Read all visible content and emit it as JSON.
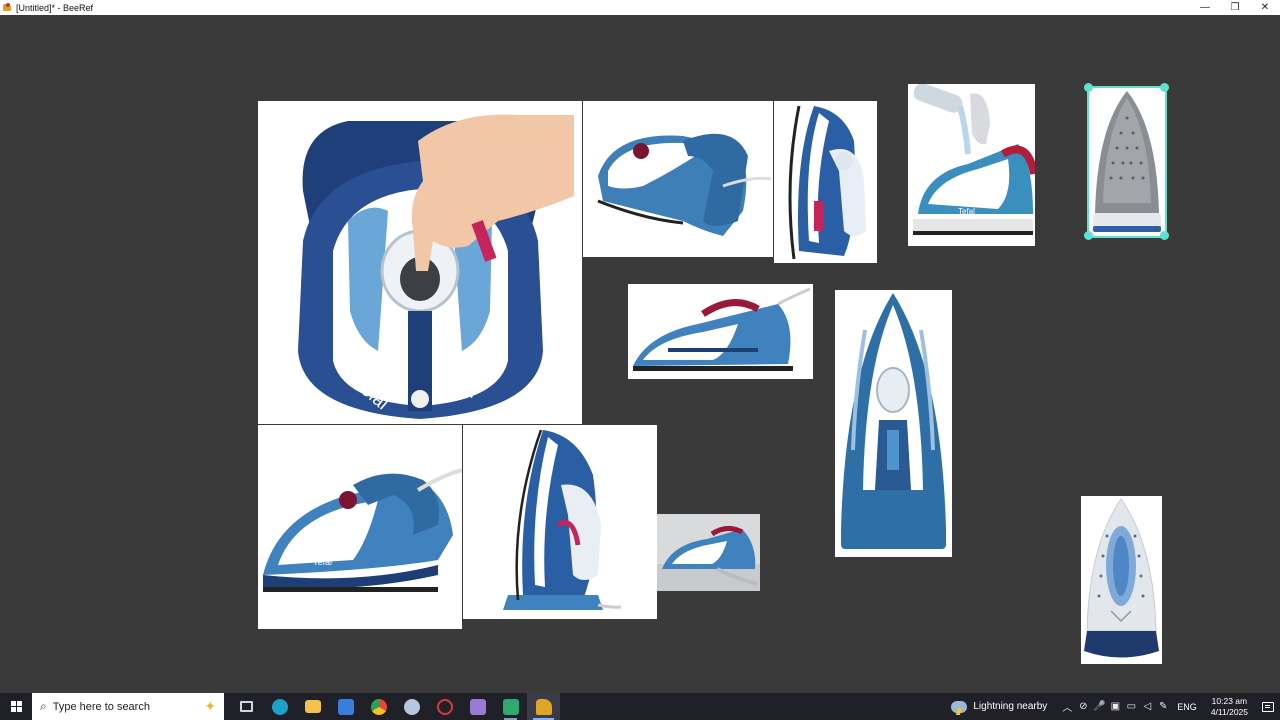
{
  "window": {
    "title": "[Untitled]* - BeeRef",
    "minimize_glyph": "—",
    "restore_glyph": "❐",
    "close_glyph": "✕"
  },
  "canvas": {
    "background": "#3a3a3a",
    "selection_color": "#5fe0d2",
    "items": [
      {
        "name": "iron-refill-closeup",
        "description_icon": "steam-iron-top-view-image"
      },
      {
        "name": "iron-angled-left",
        "description_icon": "steam-iron-image"
      },
      {
        "name": "iron-upright-side",
        "description_icon": "steam-iron-image"
      },
      {
        "name": "iron-water-pour",
        "description_icon": "steam-iron-image"
      },
      {
        "name": "iron-soleplate-grey",
        "description_icon": "soleplate-image"
      },
      {
        "name": "iron-side-view",
        "description_icon": "steam-iron-image"
      },
      {
        "name": "iron-top-view",
        "description_icon": "steam-iron-image"
      },
      {
        "name": "iron-perspective",
        "description_icon": "steam-iron-image"
      },
      {
        "name": "iron-standing",
        "description_icon": "steam-iron-image"
      },
      {
        "name": "iron-in-use",
        "description_icon": "steam-iron-image"
      },
      {
        "name": "iron-soleplate-blue",
        "description_icon": "soleplate-image"
      }
    ]
  },
  "taskbar": {
    "search_placeholder": "Type here to search",
    "weather_text": "Lightning nearby",
    "language": "ENG",
    "time": "10:23 am",
    "date": "4/11/2025",
    "apps": [
      {
        "name": "task-view-icon",
        "color": "#cfd6e0"
      },
      {
        "name": "edge-icon",
        "color": "#1fa0c8"
      },
      {
        "name": "file-explorer-icon",
        "color": "#f2c14e"
      },
      {
        "name": "store-icon",
        "color": "#3b7ddd"
      },
      {
        "name": "chrome-icon",
        "color": "#e9473b"
      },
      {
        "name": "app-icon",
        "color": "#b6c8e0"
      },
      {
        "name": "app-red-icon",
        "color": "#d83a3a"
      },
      {
        "name": "app-tool-icon",
        "color": "#9a7bd1"
      },
      {
        "name": "app-m-icon",
        "color": "#2eaa6e"
      },
      {
        "name": "beeref-icon",
        "color": "#e0a526"
      }
    ]
  }
}
